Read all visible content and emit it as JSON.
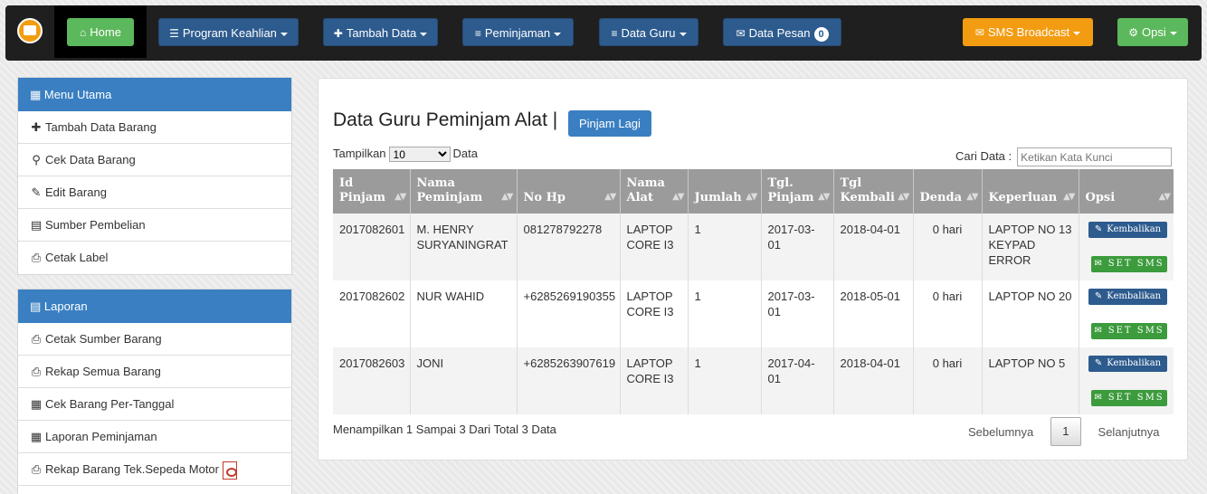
{
  "navbar": {
    "home": "Home",
    "program": "Program Keahlian",
    "tambah": "Tambah Data",
    "peminjaman": "Peminjaman",
    "guru": "Data Guru",
    "pesan": "Data Pesan",
    "pesan_count": "0",
    "sms": "SMS Broadcast",
    "opsi": "Opsi"
  },
  "menu_utama": {
    "title": "Menu Utama",
    "items": [
      {
        "label": "Tambah Data Barang",
        "icon": "plus-icon"
      },
      {
        "label": "Cek Data Barang",
        "icon": "search-icon"
      },
      {
        "label": "Edit Barang",
        "icon": "edit-icon"
      },
      {
        "label": "Sumber Pembelian",
        "icon": "list-icon"
      },
      {
        "label": "Cetak Label",
        "icon": "print-icon"
      }
    ]
  },
  "laporan": {
    "title": "Laporan",
    "items": [
      {
        "label": "Cetak Sumber Barang",
        "icon": "print-icon"
      },
      {
        "label": "Rekap Semua Barang",
        "icon": "print-icon"
      },
      {
        "label": "Cek Barang Per-Tanggal",
        "icon": "calendar-icon"
      },
      {
        "label": "Laporan Peminjaman",
        "icon": "calendar-icon"
      },
      {
        "label": "Rekap Barang Tek.Sepeda Motor",
        "icon": "print-icon"
      }
    ]
  },
  "main": {
    "title": "Data Guru Peminjam Alat |",
    "pinjam_lagi": "Pinjam Lagi",
    "show_label": "Tampilkan",
    "show_value": "10",
    "show_suffix": "Data",
    "search_label": "Cari Data :",
    "search_placeholder": "Ketikan Kata Kunci",
    "info": "Menampilkan 1 Sampai 3 Dari Total 3 Data",
    "prev": "Sebelumnya",
    "page": "1",
    "next": "Selanjutnya",
    "action_return": "Kembalikan",
    "action_sms": "SET SMS"
  },
  "table": {
    "headers": [
      "Id Pinjam",
      "Nama Peminjam",
      "No Hp",
      "Nama Alat",
      "Jumlah",
      "Tgl. Pinjam",
      "Tgl Kembali",
      "Denda",
      "Keperluan",
      "Opsi"
    ],
    "rows": [
      [
        "2017082601",
        "M. HENRY SURYANINGRAT",
        "081278792278",
        "LAPTOP CORE I3",
        "1",
        "2017-03-01",
        "2018-04-01",
        "0 hari",
        "LAPTOP NO 13 KEYPAD ERROR"
      ],
      [
        "2017082602",
        "NUR WAHID",
        "+6285269190355",
        "LAPTOP CORE I3",
        "1",
        "2017-03-01",
        "2018-05-01",
        "0 hari",
        "LAPTOP NO 20"
      ],
      [
        "2017082603",
        "JONI",
        "+6285263907619",
        "LAPTOP CORE I3",
        "1",
        "2017-04-01",
        "2018-04-01",
        "0 hari",
        "LAPTOP NO 5"
      ]
    ]
  },
  "colors": {
    "navbar": "#1f1f1f",
    "panel_header": "#3a7fc1",
    "nav_button": "#2d5b8e",
    "home_button": "#5cb85c",
    "sms_button": "#f39c12",
    "table_header": "#9b9b9b"
  }
}
